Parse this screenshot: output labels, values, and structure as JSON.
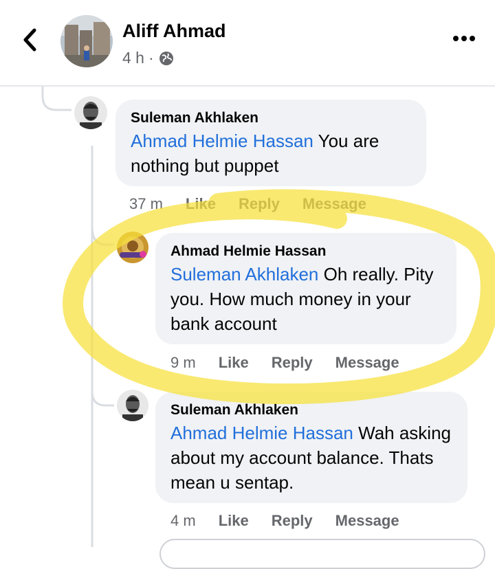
{
  "header": {
    "name": "Aliff Ahmad",
    "time": "4 h",
    "dot": "·"
  },
  "comments": [
    {
      "author": "Suleman Akhlaken",
      "mention": "Ahmad Helmie Hassan",
      "text": " You are nothing but puppet",
      "time": "37 m",
      "like": "Like",
      "reply": "Reply",
      "message": "Message"
    },
    {
      "author": "Ahmad Helmie Hassan",
      "mention": "Suleman Akhlaken",
      "text": " Oh really. Pity you. How much money in your bank account",
      "time": "9 m",
      "like": "Like",
      "reply": "Reply",
      "message": "Message"
    },
    {
      "author": "Suleman Akhlaken",
      "mention": "Ahmad Helmie Hassan",
      "text": " Wah asking about my account balance. Thats mean u sentap.",
      "time": "4 m",
      "like": "Like",
      "reply": "Reply",
      "message": "Message"
    }
  ],
  "colors": {
    "mention": "#216fdb",
    "bubble": "#f0f2f5",
    "meta": "#65676b",
    "highlight": "#f7e13a"
  },
  "icons": [
    "back-arrow-icon",
    "globe-icon",
    "more-options-icon"
  ]
}
